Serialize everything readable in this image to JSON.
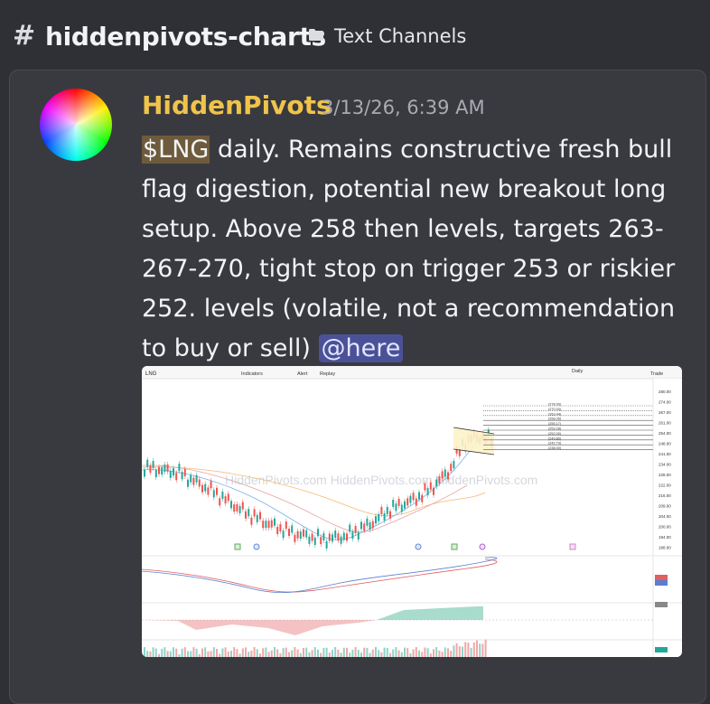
{
  "header": {
    "hash": "#",
    "channel": "hiddenpivots-charts",
    "folder_icon": "folder-icon",
    "category": "Text Channels"
  },
  "message": {
    "author": "HiddenPivots",
    "timestamp": "3/13/26, 6:39 AM",
    "ticker": "$LNG",
    "text": " daily. Remains constructive fresh bull flag digestion, potential new breakout long setup. Above 258 then levels, targets 263-267-270, tight stop on trigger 253 or riskier 252. levels (volatile, not a recommendation to buy or sell) ",
    "mention": "@here",
    "author_color": "#f0c44a"
  },
  "chart": {
    "symbol": "LNG",
    "toolbar": [
      "Indicators",
      "Alert",
      "Replay"
    ],
    "interval": "Daily",
    "trade_button": "Trade",
    "watermark": "HiddenPivots.com HiddenPivots.com HiddenPivots.com",
    "levels": [
      "(278.00)",
      "(270.00)",
      "(263.44)",
      "(258.05)",
      "(255.17)",
      "(253.28)",
      "(252.00)",
      "(249.80)",
      "(242.73)",
      "(238.00)"
    ],
    "price_axis": [
      "280.00",
      "274.00",
      "267.00",
      "261.00",
      "254.00",
      "248.00",
      "241.00",
      "234.00",
      "228.00",
      "222.00",
      "216.00",
      "209.00",
      "204.00",
      "200.00",
      "194.00",
      "188.00"
    ]
  }
}
